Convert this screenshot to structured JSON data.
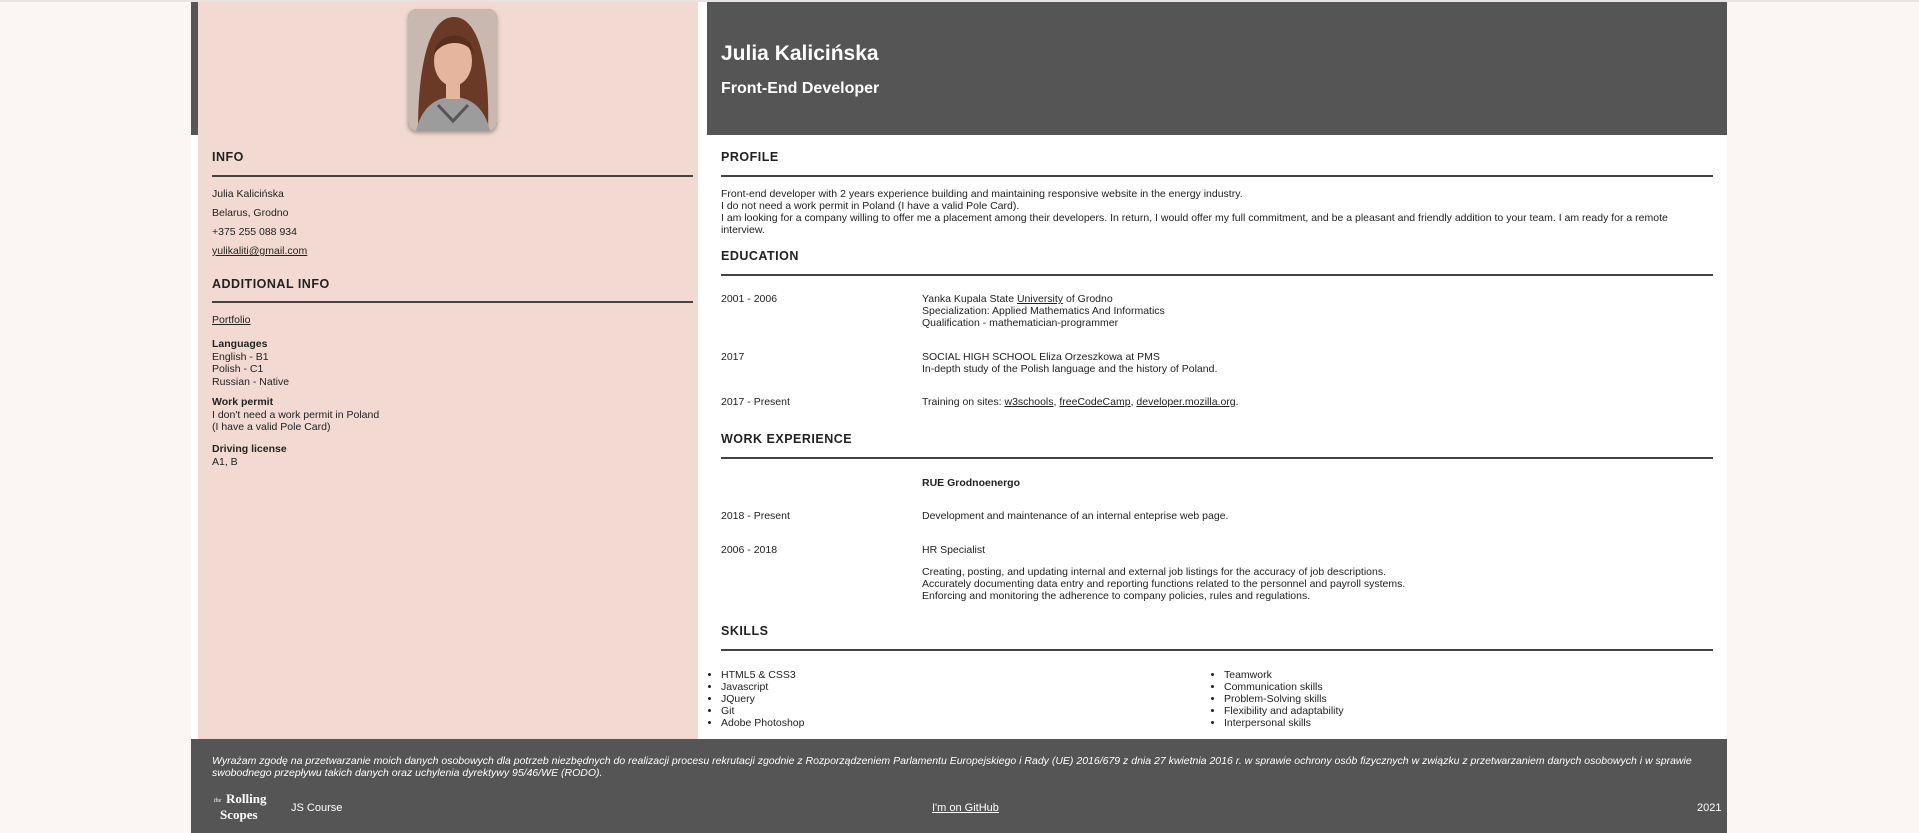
{
  "header": {
    "name": "Julia Kalicińska",
    "role": "Front-End Developer"
  },
  "info": {
    "title": "INFO",
    "name": "Julia Kalicińska",
    "location": "Belarus, Grodno",
    "phone": "+375 255 088 934",
    "email": "yulikaliti@gmail.com"
  },
  "additional_info": {
    "title": "ADDITIONAL INFO",
    "portfolio_link": "Portfolio",
    "languages_label": "Languages",
    "languages": [
      "English - B1",
      "Polish - C1",
      "Russian - Native"
    ],
    "work_permit_label": "Work permit",
    "work_permit": [
      "I don't need a work permit in Poland",
      "(I have a valid Pole Card)"
    ],
    "driving_label": "Driving license",
    "driving": "A1, B"
  },
  "profile": {
    "title": "PROFILE",
    "lines": [
      "Front-end developer with 2 years experience building and maintaining responsive website in the energy industry.",
      "I do not need a work permit in Poland (I have a valid Pole Card).",
      "I am looking for a company willing to offer me a placement among their developers. In return, I would offer my full commitment, and be a pleasant and friendly addition to your team. I am ready for a remote interview."
    ]
  },
  "education": {
    "title": "EDUCATION",
    "items": [
      {
        "period": "2001 - 2006",
        "line1_pre": "Yanka Kupala State ",
        "line1_link": "University",
        "line1_post": " of Grodno",
        "line2": "Specialization: Applied Mathematics And Informatics",
        "line3": "Qualification - mathematician-programmer"
      },
      {
        "period": "2017",
        "line1": "SOCIAL HIGH SCHOOL Eliza Orzeszkowa at PMS",
        "line2": "In-depth study of the Polish language and the history of Poland."
      },
      {
        "period": "2017 - Present",
        "pre": "Training on sites: ",
        "links": [
          "w3schools",
          "freeCodeCamp",
          "developer.mozilla.org"
        ]
      }
    ]
  },
  "work": {
    "title": "WORK EXPERIENCE",
    "company": "RUE Grodnoenergo",
    "items": [
      {
        "period": "2018 - Present",
        "desc": "Development and maintenance of an internal enteprise web page."
      },
      {
        "period": "2006 - 2018",
        "desc": "HR Specialist"
      }
    ],
    "hr_details": [
      "Creating, posting, and updating internal and external job listings for the accuracy of job descriptions.",
      "Accurately documenting data entry and reporting functions related to the personnel and payroll systems.",
      "Enforcing and monitoring the adherence to company policies, rules and regulations."
    ]
  },
  "skills": {
    "title": "SKILLS",
    "left": [
      "HTML5 & CSS3",
      "Javascript",
      "JQuery",
      "Git",
      "Adobe Photoshop"
    ],
    "right": [
      "Teamwork",
      "Communication skills",
      "Problem-Solving skills",
      "Flexibility and adaptability",
      "Interpersonal skills"
    ]
  },
  "footer": {
    "consent": "Wyrażam zgodę na przetwarzanie moich danych osobowych dla potrzeb niezbędnych do realizacji procesu rekrutacji zgodnie z Rozporządzeniem Parlamentu Europejskiego i Rady (UE) 2016/679 z dnia 27 kwietnia 2016 r. w sprawie ochrony osób fizycznych w związku z przetwarzaniem danych osobowych i w sprawie swobodnego przepływu takich danych oraz uchylenia dyrektywy 95/46/WE (RODO).",
    "logo_text_1": "Rolling",
    "logo_text_2": "Scopes",
    "course": "JS Course",
    "github": "I'm on GitHub",
    "year": "2021"
  }
}
